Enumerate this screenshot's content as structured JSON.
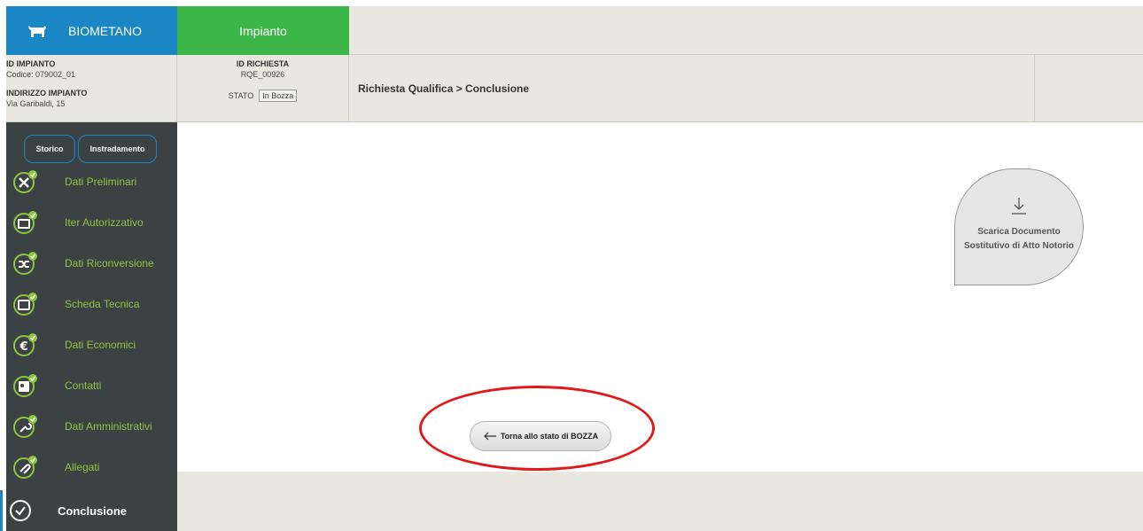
{
  "header": {
    "brand_label": "BIOMETANO",
    "tab_label": "Impianto"
  },
  "info": {
    "id_impianto_label": "ID IMPIANTO",
    "codice": "Codice: 079002_01",
    "indirizzo_label": "INDIRIZZO IMPIANTO",
    "indirizzo": "Via Garibaldi, 15",
    "id_richiesta_label": "ID RICHIESTA",
    "id_richiesta": "RQE_00926",
    "stato_label": "STATO",
    "stato_value": "In Bozza",
    "breadcrumb": "Richiesta Qualifica > Conclusione"
  },
  "sidebar": {
    "storico_label": "Storico",
    "instradamento_label": "Instradamento",
    "items": [
      {
        "label": "Dati Preliminari",
        "icon": "tools-icon"
      },
      {
        "label": "Iter Autorizzativo",
        "icon": "calendar-icon"
      },
      {
        "label": "Dati Riconversione",
        "icon": "shuffle-icon"
      },
      {
        "label": "Scheda Tecnica",
        "icon": "wallet-icon"
      },
      {
        "label": "Dati Economici",
        "icon": "euro-icon"
      },
      {
        "label": "Contatti",
        "icon": "contact-card-icon"
      },
      {
        "label": "Dati Amministrativi",
        "icon": "wrench-icon"
      },
      {
        "label": "Allegati",
        "icon": "paperclip-icon"
      },
      {
        "label": "Conclusione",
        "icon": "check-circle-icon"
      }
    ]
  },
  "main": {
    "download_label": "Scarica Documento Sostitutivo di Atto Notorio",
    "back_label": "Torna allo stato di BOZZA"
  },
  "colors": {
    "brand_blue": "#1a86c4",
    "brand_green": "#3cb648",
    "sidebar_bg": "#3c4144",
    "sidebar_text": "#8dc63f",
    "annotation_red": "#e01a1a"
  }
}
